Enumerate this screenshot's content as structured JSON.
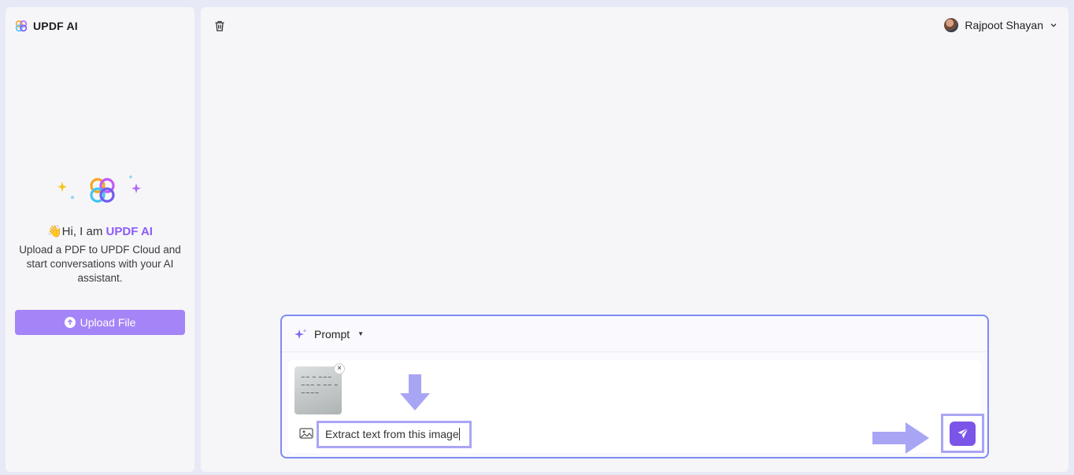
{
  "sidebar": {
    "brand_name": "UPDF AI",
    "greeting_prefix": "👋Hi, I am ",
    "greeting_highlight": "UPDF AI",
    "intro_text": "Upload a PDF to UPDF Cloud and start conversations with your AI assistant.",
    "upload_button_label": "Upload File"
  },
  "header": {
    "user_name": "Rajpoot Shayan"
  },
  "composer": {
    "prompt_label": "Prompt",
    "input_value": "Extract text from this image"
  },
  "colors": {
    "accent": "#7b55e8",
    "upload_button": "#a584f7",
    "highlight_box": "#a9a5f5",
    "composer_border": "#7d8cf2"
  },
  "icons": [
    "updf-logo-icon",
    "sparkle-icon",
    "upload-icon",
    "trash-icon",
    "chevron-down-icon",
    "caret-down-icon",
    "close-icon",
    "image-icon",
    "send-icon",
    "arrow-down-icon",
    "arrow-right-icon"
  ]
}
